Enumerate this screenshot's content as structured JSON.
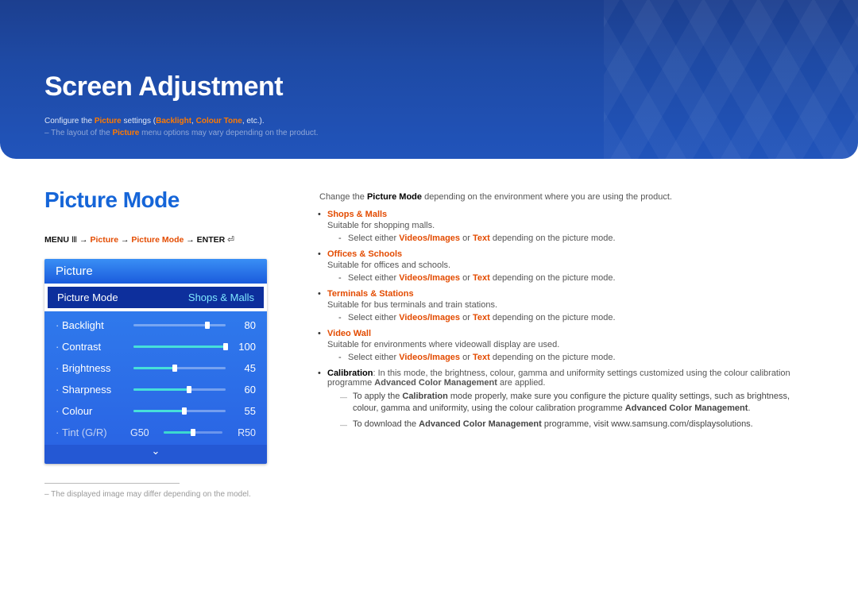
{
  "banner": {
    "title": "Screen Adjustment",
    "sub1_pre": "Configure the ",
    "sub1_hi1": "Picture",
    "sub1_mid": " settings (",
    "sub1_hi2": "Backlight",
    "sub1_sep": ", ",
    "sub1_hi3": "Colour Tone",
    "sub1_post": ", etc.).",
    "sub2_pre": "– The layout of the ",
    "sub2_hi": "Picture",
    "sub2_post": " menu options may vary depending on the product."
  },
  "left": {
    "heading": "Picture Mode",
    "bc_menu": "MENU ",
    "bc_icon1": "Ⅲ",
    "bc_arr": " → ",
    "bc_p1": "Picture",
    "bc_p2": "Picture Mode",
    "bc_end": " → ENTER ",
    "bc_icon2": "⏎",
    "menu_title": "Picture",
    "sel_label": "Picture Mode",
    "sel_value": "Shops & Malls",
    "items": {
      "backlight": {
        "name": "Backlight",
        "value": "80",
        "pct": "80%"
      },
      "contrast": {
        "name": "Contrast",
        "value": "100",
        "pct": "100%"
      },
      "brightness": {
        "name": "Brightness",
        "value": "45",
        "pct": "45%"
      },
      "sharpness": {
        "name": "Sharpness",
        "value": "60",
        "pct": "60%"
      },
      "colour": {
        "name": "Colour",
        "value": "55",
        "pct": "55%"
      }
    },
    "tint": {
      "name": "Tint (G/R)",
      "g": "G50",
      "r": "R50"
    },
    "chevron": "⌄",
    "footnote": "– The displayed image may differ depending on the model."
  },
  "right": {
    "intro_pre": "Change the ",
    "intro_b": "Picture Mode",
    "intro_post": " depending on the environment where you are using the product.",
    "shops": {
      "title": "Shops & Malls",
      "desc": "Suitable for shopping malls.",
      "sub_pre": "Select either ",
      "sub_hi1": "Videos/Images",
      "sub_or": " or ",
      "sub_hi2": "Text",
      "sub_post": " depending on the picture mode."
    },
    "offices": {
      "title": "Offices & Schools",
      "desc": "Suitable for offices and schools.",
      "sub_pre": "Select either ",
      "sub_hi1": "Videos/Images",
      "sub_or": " or ",
      "sub_hi2": "Text",
      "sub_post": " depending on the picture mode."
    },
    "terminals": {
      "title": "Terminals & Stations",
      "desc": "Suitable for bus terminals and train stations.",
      "sub_pre": "Select either ",
      "sub_hi1": "Videos/Images",
      "sub_or": " or ",
      "sub_hi2": "Text",
      "sub_post": " depending on the picture mode."
    },
    "videowall": {
      "title": "Video Wall",
      "desc": "Suitable for environments where videowall display are used.",
      "sub_pre": "Select either ",
      "sub_hi1": "Videos/Images",
      "sub_or": " or ",
      "sub_hi2": "Text",
      "sub_post": " depending on the picture mode."
    },
    "calib": {
      "label": "Calibration",
      "text_pre": ": In this mode, the brightness, colour, gamma and uniformity settings customized using the colour calibration programme ",
      "text_b": "Advanced Color Management",
      "text_post": " are applied.",
      "note1_pre": "To apply the ",
      "note1_b1": "Calibration",
      "note1_mid": " mode properly, make sure you configure the picture quality settings, such as brightness, colour, gamma and uniformity, using the colour calibration programme ",
      "note1_b2": "Advanced Color Management",
      "note1_post": ".",
      "note2_pre": "To download the ",
      "note2_b": "Advanced Color Management",
      "note2_post": " programme, visit www.samsung.com/displaysolutions."
    }
  }
}
